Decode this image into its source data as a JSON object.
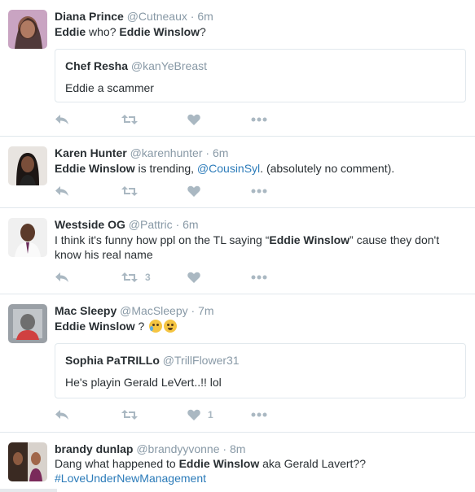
{
  "tweets": [
    {
      "name": "Diana Prince",
      "handle": "@Cutneaux",
      "time": "6m",
      "text_parts": [
        "Eddie",
        " who? ",
        "Eddie Winslow",
        "?"
      ],
      "quote": {
        "name": "Chef Resha",
        "handle": "@kanYeBreast",
        "text": "Eddie a scammer"
      },
      "retweets": "",
      "likes": ""
    },
    {
      "name": "Karen Hunter",
      "handle": "@karenhunter",
      "time": "6m",
      "text_parts": [
        "Eddie Winslow",
        " is trending, ",
        "@CousinSyl",
        ". (absolutely no comment)."
      ],
      "retweets": "",
      "likes": ""
    },
    {
      "name": "Westside OG",
      "handle": "@Pattric",
      "time": "6m",
      "text_parts": [
        "I think it's funny how ppl on the TL saying “",
        "Eddie Winslow",
        "” cause they don't know his real name"
      ],
      "retweets": "3",
      "likes": ""
    },
    {
      "name": "Mac Sleepy",
      "handle": "@MacSleepy",
      "time": "7m",
      "text_parts": [
        "Eddie Winslow",
        " ? "
      ],
      "emoji": [
        "crying-face-emoji",
        "tears-of-joy-emoji"
      ],
      "quote": {
        "name": "Sophia PaTRILLo",
        "handle": "@TrillFlower31",
        "text": "He's playin Gerald LeVert..!! lol"
      },
      "retweets": "",
      "likes": "1"
    },
    {
      "name": "brandy dunlap",
      "handle": "@brandyyvonne",
      "time": "8m",
      "text_parts": [
        "Dang what happened to ",
        "Eddie Winslow",
        " aka Gerald Lavert??"
      ],
      "hashtag": "#LoveUnderNewManagement"
    }
  ],
  "separator": "·",
  "colors": {
    "link": "#2b7bb9",
    "muted": "#8899a6",
    "icon": "#aab8c2",
    "border": "#e1e8ed"
  },
  "icons": [
    "reply-icon",
    "retweet-icon",
    "like-icon",
    "more-icon"
  ]
}
